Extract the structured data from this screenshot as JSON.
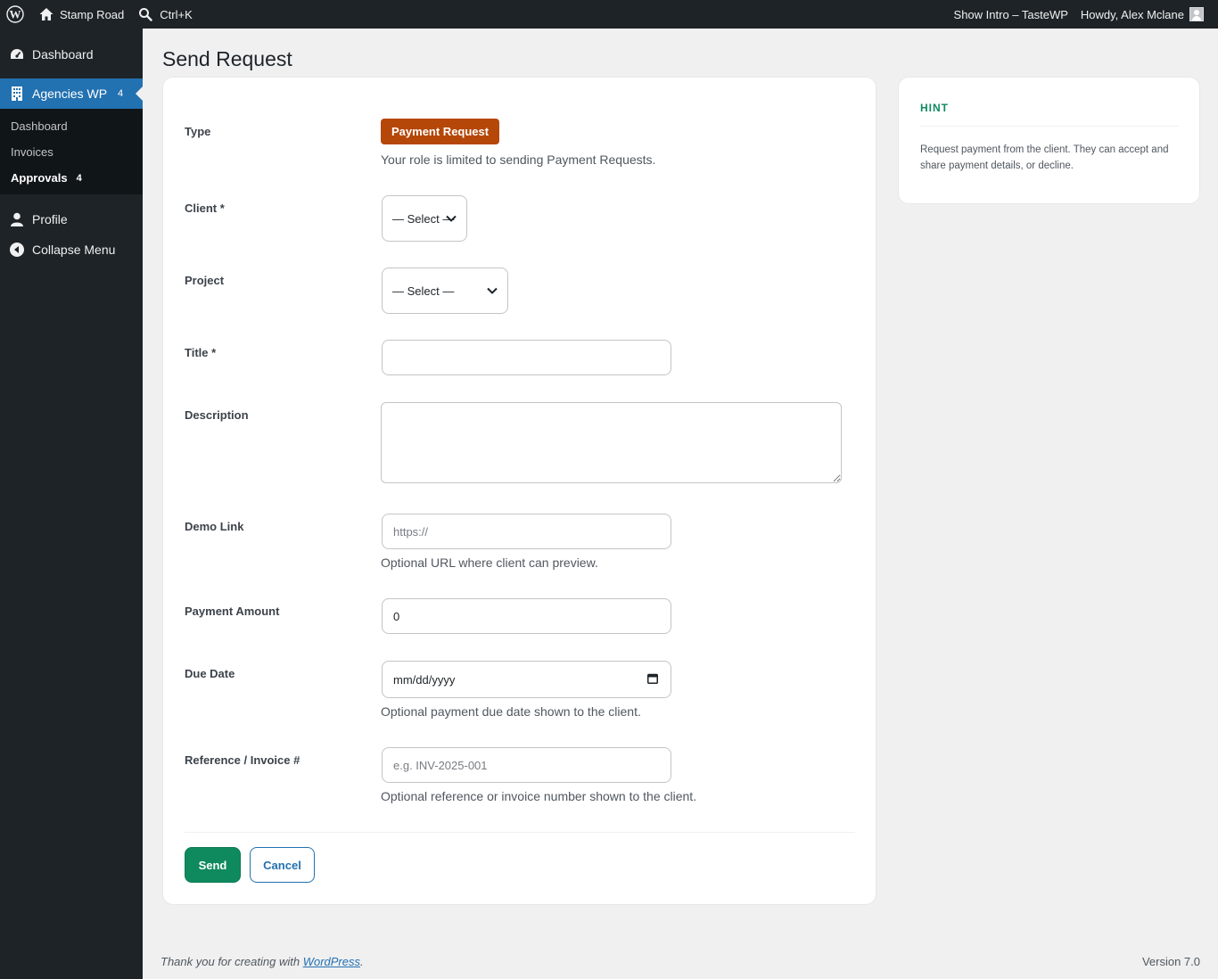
{
  "adminbar": {
    "site_name": "Stamp Road",
    "search_shortcut": "Ctrl+K",
    "show_intro": "Show Intro – TasteWP",
    "howdy": "Howdy, Alex Mclane"
  },
  "sidebar": {
    "items": [
      {
        "label": "Dashboard",
        "icon": "dashboard-icon"
      },
      {
        "label": "Agencies WP",
        "icon": "building-icon",
        "badge": "4"
      }
    ],
    "submenu": [
      {
        "label": "Dashboard"
      },
      {
        "label": "Invoices"
      },
      {
        "label": "Approvals",
        "badge": "4"
      }
    ],
    "bottom_items": [
      {
        "label": "Profile",
        "icon": "user-icon"
      },
      {
        "label": "Collapse Menu",
        "icon": "collapse-icon"
      }
    ]
  },
  "page": {
    "title": "Send Request"
  },
  "form": {
    "type_label": "Type",
    "type_value": "Payment Request",
    "type_help": "Your role is limited to sending Payment Requests.",
    "client_label": "Client *",
    "client_value": "— Select —",
    "project_label": "Project",
    "project_value": "— Select —",
    "title_label": "Title *",
    "title_value": "",
    "description_label": "Description",
    "description_value": "",
    "demo_label": "Demo Link",
    "demo_placeholder": "https://",
    "demo_help": "Optional URL where client can preview.",
    "amount_label": "Payment Amount",
    "amount_value": "0",
    "due_label": "Due Date",
    "due_value": "mm/dd/yyyy",
    "due_help": "Optional payment due date shown to the client.",
    "ref_label": "Reference / Invoice #",
    "ref_placeholder": "e.g. INV-2025-001",
    "ref_help": "Optional reference or invoice number shown to the client.",
    "send_label": "Send",
    "cancel_label": "Cancel"
  },
  "hint": {
    "title": "HINT",
    "text": "Request payment from the client. They can accept and share payment details, or decline."
  },
  "footer": {
    "thanks_prefix": "Thank you for creating with ",
    "thanks_link": "WordPress",
    "thanks_suffix": ".",
    "version": "Version 7.0"
  },
  "colors": {
    "accent": "#2271b1",
    "send_button": "#0f8a5f",
    "type_badge": "#b54708",
    "hint_title": "#0f8a5f"
  }
}
